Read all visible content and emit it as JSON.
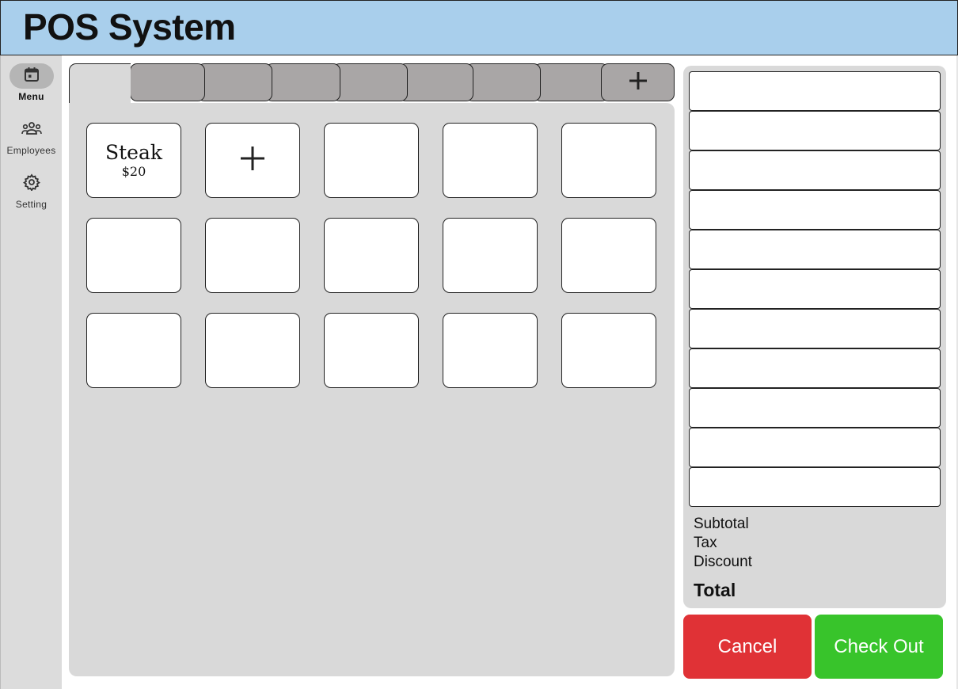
{
  "app": {
    "title": "POS System"
  },
  "sidebar": {
    "items": [
      {
        "label": "Menu",
        "icon": "calendar-icon",
        "active": true
      },
      {
        "label": "Employees",
        "icon": "employees-icon",
        "active": false
      },
      {
        "label": "Setting",
        "icon": "gear-icon",
        "active": false
      }
    ]
  },
  "category_tabs": {
    "count": 9,
    "active_index": 0,
    "add_icon": "plus-icon"
  },
  "menu_grid": {
    "items": [
      {
        "name": "Steak",
        "price": "$20"
      }
    ],
    "add_icon": "plus-icon"
  },
  "order": {
    "rows": 11,
    "subtotal_label": "Subtotal",
    "tax_label": "Tax",
    "discount_label": "Discount",
    "total_label": "Total"
  },
  "actions": {
    "cancel_label": "Cancel",
    "checkout_label": "Check Out"
  },
  "colors": {
    "header_bg": "#a9cfec",
    "panel_bg": "#d9d9d9",
    "tab_bg": "#a9a6a6",
    "cancel": "#e03236",
    "checkout": "#38c42b"
  }
}
